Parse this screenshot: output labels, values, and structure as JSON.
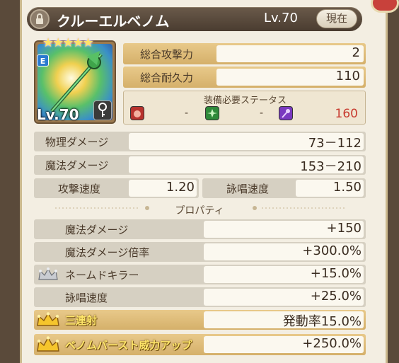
{
  "header": {
    "title": "クルーエルベノム",
    "level": "Lv.70",
    "now_button": "現在",
    "lock_icon": "lock-icon"
  },
  "item": {
    "rank": "E",
    "level": "Lv.70",
    "stars": "★★★★★",
    "key_icon": "key-icon"
  },
  "summary": {
    "attack_label": "総合攻撃力",
    "attack_value": "2",
    "durability_label": "総合耐久力",
    "durability_value": "110"
  },
  "requirements": {
    "title": "装備必要ステータス",
    "str": "-",
    "dex": "-",
    "int": "160"
  },
  "stats": {
    "phys_label": "物理ダメージ",
    "phys_value": "73－112",
    "magic_label": "魔法ダメージ",
    "magic_value": "153－210",
    "atkspd_label": "攻撃速度",
    "atkspd_value": "1.20",
    "castspd_label": "詠唱速度",
    "castspd_value": "1.50"
  },
  "properties": {
    "title": "プロパティ",
    "rows": [
      {
        "label": "魔法ダメージ",
        "value": "+150"
      },
      {
        "label": "魔法ダメージ倍率",
        "value": "+300.0%"
      },
      {
        "label": "ネームドキラー",
        "value": "+15.0%"
      },
      {
        "label": "詠唱速度",
        "value": "+25.0%"
      },
      {
        "label": "三連射",
        "value": "発動率15.0%"
      },
      {
        "label": "ベノムバースト威力アップ",
        "value": "+250.0%"
      }
    ]
  },
  "colors": {
    "gold": "#e8c98a",
    "red_value": "#c83c30",
    "header_bg": "#5a4a3a"
  }
}
